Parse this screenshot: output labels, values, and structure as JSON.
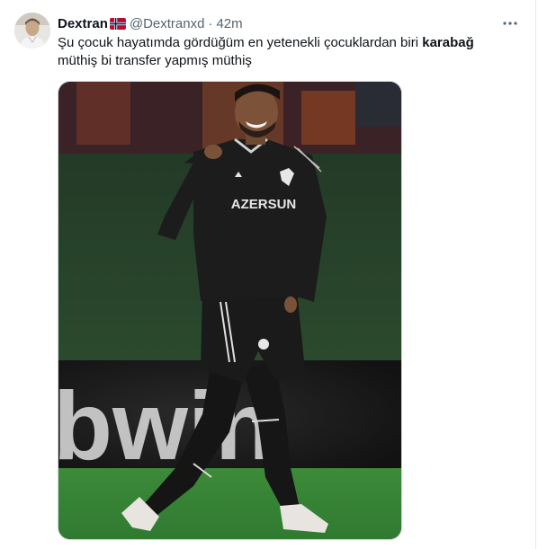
{
  "tweet": {
    "display_name": "Dextran",
    "flag_icon": "norway-flag-icon",
    "handle": "@Dextranxd",
    "separator": "·",
    "time": "42m",
    "text_before": "Şu çocuk hayatımda gördüğüm en yetenekli çocuklardan biri ",
    "text_bold": "karabağ",
    "text_after": "müthiş bi transfer yapmış müthiş",
    "media": {
      "shirt_sponsor": "AZERSUN",
      "board_text": "bwin"
    }
  },
  "colors": {
    "text": "#0f1419",
    "secondary": "#536471",
    "border": "#cfd9de",
    "flag_red": "#ba0c2f",
    "flag_blue": "#00205b"
  }
}
